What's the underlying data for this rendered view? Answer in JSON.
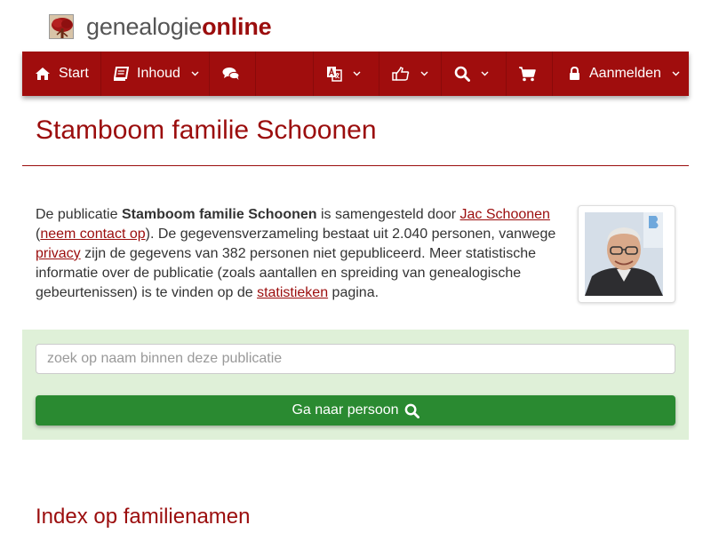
{
  "brand": {
    "part1": "genealogie",
    "part2": "online"
  },
  "nav": {
    "start_label": "Start",
    "inhoud_label": "Inhoud",
    "aanmelden_label": "Aanmelden"
  },
  "icons": {
    "home": "home-icon",
    "book": "book-icon",
    "comments": "comments-icon",
    "translate": "translate-icon",
    "thumbs": "thumbs-up-icon",
    "search": "search-icon",
    "cart": "shopping-cart-icon",
    "lock": "lock-icon",
    "chevron": "chevron-down-icon"
  },
  "page": {
    "title": "Stamboom familie Schoonen",
    "intro": {
      "t1": "De publicatie ",
      "pub_name": "Stamboom familie Schoonen",
      "t2": " is samengesteld door ",
      "author": "Jac Schoonen",
      "t3": " (",
      "contact": "neem contact op",
      "t4": "). De gegevensverzameling bestaat uit 2.040 personen, vanwege ",
      "privacy": "privacy",
      "t5": " zijn de gegevens van 382 personen niet gepubliceerd. Meer statistische informatie over de publicatie (zoals aantallen en spreiding van genealogische gebeurtenissen) is te vinden op de ",
      "stats": "statistieken",
      "t6": " pagina."
    }
  },
  "search": {
    "placeholder": "zoek op naam binnen deze publicatie",
    "value": "",
    "button_label": "Ga naar persoon"
  },
  "index": {
    "title": "Index op familienamen"
  },
  "colors": {
    "brand_red": "#a00d0d",
    "title_red": "#9b0d0d",
    "search_bg": "#dff0d8",
    "button_green": "#2a8a31"
  }
}
